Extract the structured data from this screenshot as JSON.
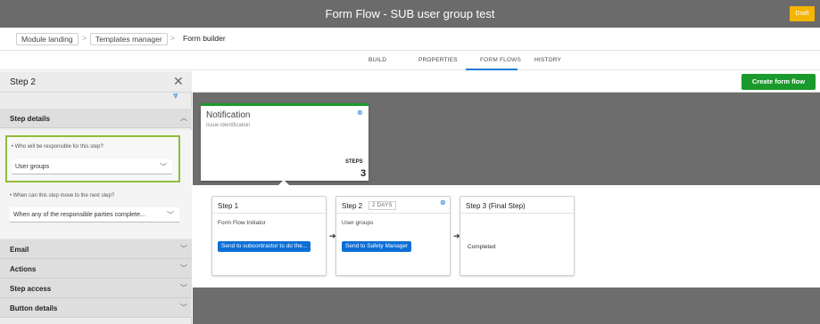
{
  "window": {
    "title": "Form Flow - SUB user group test",
    "status_badge": "Draft"
  },
  "breadcrumb": {
    "items": [
      "Module landing",
      "Templates manager",
      "Form builder"
    ]
  },
  "tabs": [
    {
      "label": "BUILD",
      "active": false
    },
    {
      "label": "PROPERTIES",
      "active": false
    },
    {
      "label": "FORM FLOWS",
      "active": true
    },
    {
      "label": "HISTORY",
      "active": false
    }
  ],
  "left_panel": {
    "title": "Step 2",
    "sections": {
      "step_details": "Step details",
      "email": "Email",
      "actions": "Actions",
      "step_access": "Step access",
      "button_details": "Button details"
    },
    "responsible": {
      "label": "• Who will be responsible for this step?",
      "value": "User groups"
    },
    "next_step": {
      "label": "• When can this step move to the next step?",
      "value": "When any of the responsible parties complete..."
    }
  },
  "toolbar": {
    "create_button": "Create form flow"
  },
  "notification": {
    "title": "Notification",
    "subtitle": "Issue identification",
    "steps_label": "STEPS",
    "steps_count": "3"
  },
  "steps": [
    {
      "title": "Step 1",
      "assignee": "Form Flow Initiator",
      "action": "Send to subcontractor to do the..."
    },
    {
      "title": "Step 2",
      "days": "2 DAYS",
      "assignee": "User groups",
      "action": "Send to Safety Manager"
    },
    {
      "title": "Step 3 (Final Step)",
      "completed": "Completed"
    }
  ],
  "colors": {
    "accent": "#1e7bd6",
    "create_button": "#1a9a2c",
    "highlight": "#8fbc3a",
    "draft_badge": "#f4b400",
    "action_button": "#0d6fd6"
  }
}
